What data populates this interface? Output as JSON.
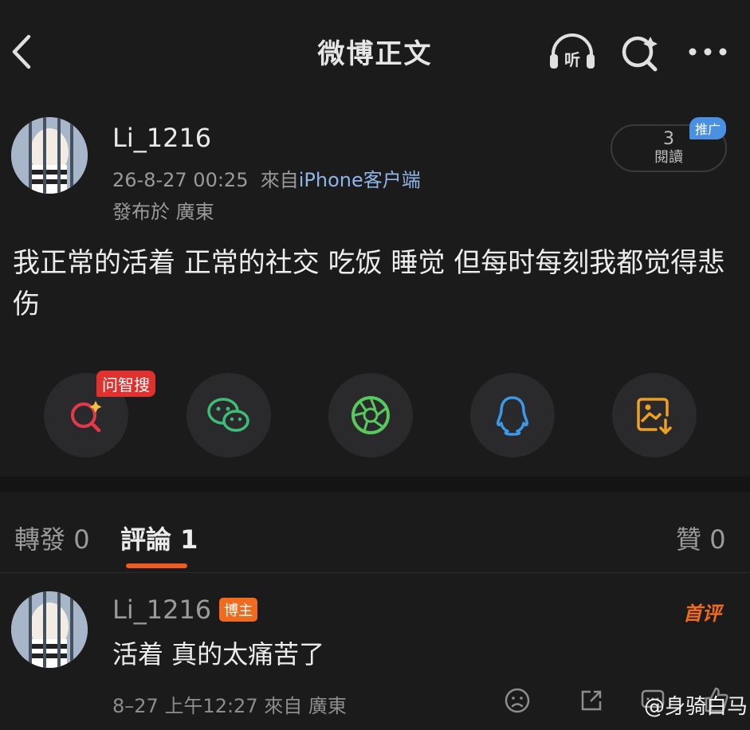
{
  "header": {
    "title": "微博正文",
    "listen_label": "听"
  },
  "post": {
    "username": "Li_1216",
    "time": "26-8-27 00:25",
    "source_prefix": "來自",
    "source_device": "iPhone客户端",
    "location": "發布於 廣東",
    "reads_count": "3",
    "reads_label": "閱讀",
    "promo_badge": "推广",
    "content": "我正常的活着 正常的社交 吃饭 睡觉 但每时每刻我都觉得悲伤"
  },
  "share_bar": {
    "wenzhi_badge": "问智搜",
    "items": [
      "search-sparkle-icon",
      "wechat-icon",
      "moments-icon",
      "qq-icon",
      "save-image-icon"
    ],
    "colors": {
      "search": "#e23a4a",
      "wechat": "#3dbd77",
      "moments": "#58c95c",
      "qq": "#3a9ae8",
      "save": "#f0a020"
    }
  },
  "tabs": {
    "repost_label": "轉發",
    "repost_count": "0",
    "comment_label": "評論",
    "comment_count": "1",
    "like_label": "贊",
    "like_count": "0"
  },
  "comment": {
    "username": "Li_1216",
    "author_badge": "博主",
    "first_badge": "首评",
    "text": "活着 真的太痛苦了",
    "meta": "8–27 上午12:27 來自 廣東"
  },
  "watermark": "@身骑白马",
  "accent_color": "#f05a1a"
}
